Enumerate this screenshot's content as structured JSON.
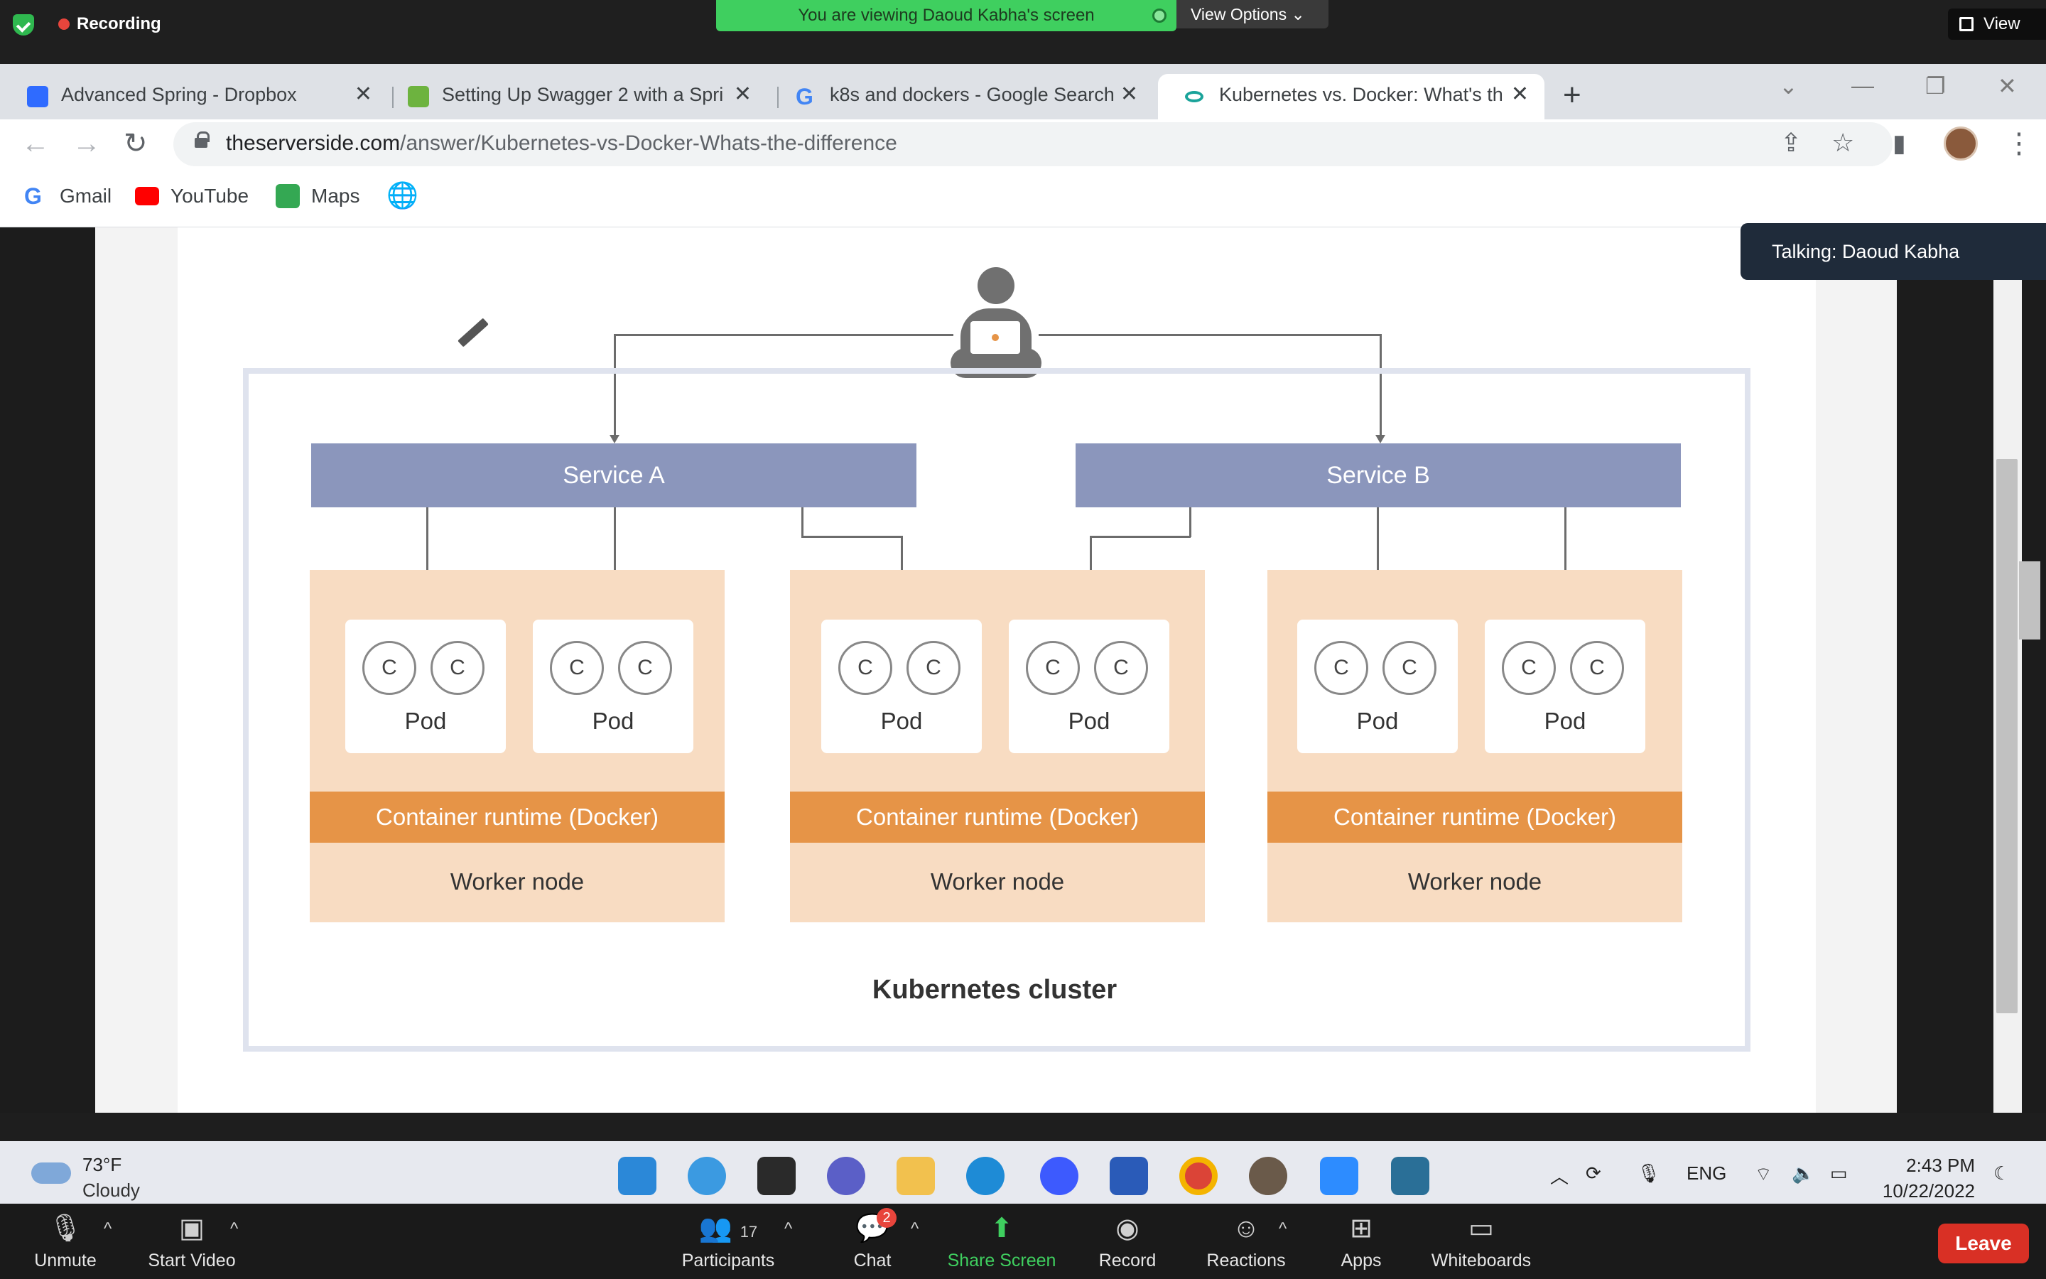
{
  "zoom_top": {
    "recording": "Recording",
    "banner": "You are viewing Daoud Kabha's screen",
    "view_options": "View Options ⌄",
    "view": "View"
  },
  "tabs": [
    {
      "title": "Advanced Spring - Dropbox",
      "fav_color": "#2f6bff"
    },
    {
      "title": "Setting Up Swagger 2 with a Spri",
      "fav_color": "#6db33f"
    },
    {
      "title": "k8s and dockers - Google Search",
      "fav_color": "#ffffff"
    },
    {
      "title": "Kubernetes vs. Docker: What's th",
      "fav_color": "#ffffff"
    }
  ],
  "url": {
    "host": "theserverside.com",
    "path": "/answer/Kubernetes-vs-Docker-Whats-the-difference"
  },
  "bookmarks": [
    {
      "label": "Gmail",
      "color": "#4285f4"
    },
    {
      "label": "YouTube",
      "color": "#ff0000"
    },
    {
      "label": "Maps",
      "color": "#34a853"
    }
  ],
  "talking": "Talking: Daoud Kabha",
  "diagram": {
    "service_a": "Service A",
    "service_b": "Service B",
    "container": "C",
    "pod": "Pod",
    "runtime": "Container runtime (Docker)",
    "worker": "Worker node",
    "cluster": "Kubernetes cluster"
  },
  "taskbar": {
    "temp": "73°F",
    "sky": "Cloudy",
    "lang": "ENG",
    "time": "2:43 PM",
    "date": "10/22/2022"
  },
  "zoom_bottom": {
    "unmute": "Unmute",
    "start_video": "Start Video",
    "participants": "Participants",
    "participants_count": "17",
    "chat": "Chat",
    "chat_badge": "2",
    "share": "Share Screen",
    "record": "Record",
    "reactions": "Reactions",
    "apps": "Apps",
    "whiteboards": "Whiteboards",
    "leave": "Leave"
  }
}
